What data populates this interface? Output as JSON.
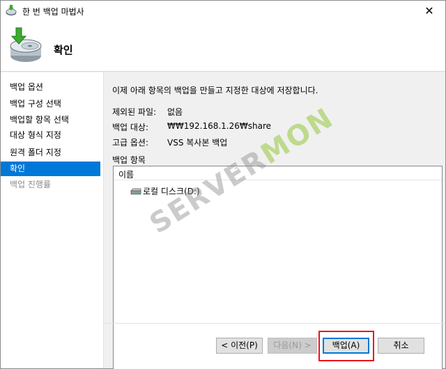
{
  "window": {
    "title": "한 번 백업 마법사",
    "close_glyph": "✕"
  },
  "header": {
    "title": "확인"
  },
  "sidebar": {
    "items": [
      {
        "label": "백업 옵션",
        "state": "normal"
      },
      {
        "label": "백업 구성 선택",
        "state": "normal"
      },
      {
        "label": "백업할 항목 선택",
        "state": "normal"
      },
      {
        "label": "대상 형식 지정",
        "state": "normal"
      },
      {
        "label": "원격 폴더 지정",
        "state": "normal"
      },
      {
        "label": "확인",
        "state": "active"
      },
      {
        "label": "백업 진행률",
        "state": "disabled"
      }
    ]
  },
  "main": {
    "intro": "이제 아래 항목의 백업을 만들고 지정한 대상에 저장합니다.",
    "rows": [
      {
        "label": "제외된 파일:",
        "value": "없음"
      },
      {
        "label": "백업 대상:",
        "value": "₩₩192.168.1.26₩share"
      },
      {
        "label": "고급 옵션:",
        "value": "VSS 복사본 백업"
      }
    ],
    "items_label": "백업 항목",
    "list": {
      "column": "이름",
      "items": [
        "로컬 디스크(D:)"
      ]
    }
  },
  "buttons": {
    "prev": "< 이전(P)",
    "next": "다음(N) >",
    "backup": "백업(A)",
    "cancel": "취소"
  },
  "watermark": {
    "text_main": "SERVER",
    "text_accent": "MON"
  },
  "colors": {
    "accent": "#0078d7",
    "highlight_box": "#e8141c"
  },
  "icons": {
    "app": "backup-wizard-icon",
    "header": "backup-disk-icon",
    "drive": "drive-icon",
    "close": "close-icon"
  }
}
